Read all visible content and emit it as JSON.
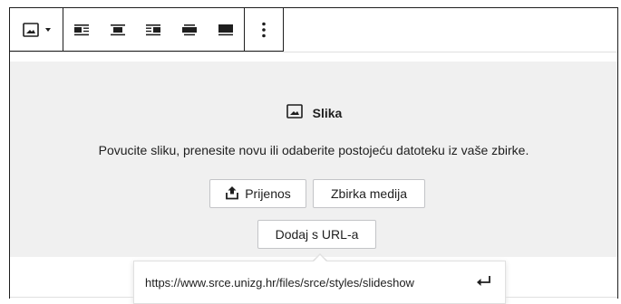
{
  "toolbar": {
    "block_type_icon": "image-block-icon",
    "block_type_dropdown_icon": "caret-down-icon",
    "align_buttons": [
      {
        "icon": "align-left-icon"
      },
      {
        "icon": "align-center-icon"
      },
      {
        "icon": "align-right-icon"
      },
      {
        "icon": "align-wide-icon"
      },
      {
        "icon": "align-full-icon"
      }
    ],
    "more_options_icon": "more-vertical-icon"
  },
  "placeholder": {
    "title": "Slika",
    "title_icon": "image-icon",
    "instructions": "Povucite sliku, prenesite novu ili odaberite postojeću datoteku iz vaše zbirke.",
    "upload_label": "Prijenos",
    "upload_icon": "upload-icon",
    "library_label": "Zbirka medija",
    "url_label": "Dodaj s URL-a"
  },
  "url_popover": {
    "value": "https://www.srce.unizg.hr/files/srce/styles/slideshow",
    "submit_icon": "enter-arrow-icon"
  }
}
